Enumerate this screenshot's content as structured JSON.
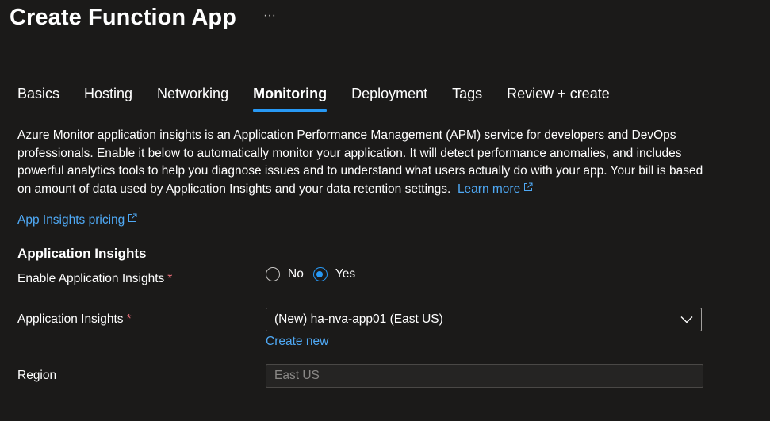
{
  "header": {
    "title": "Create Function App",
    "more_label": "···"
  },
  "tabs": [
    {
      "label": "Basics",
      "active": false
    },
    {
      "label": "Hosting",
      "active": false
    },
    {
      "label": "Networking",
      "active": false
    },
    {
      "label": "Monitoring",
      "active": true
    },
    {
      "label": "Deployment",
      "active": false
    },
    {
      "label": "Tags",
      "active": false
    },
    {
      "label": "Review + create",
      "active": false
    }
  ],
  "description": {
    "text": "Azure Monitor application insights is an Application Performance Management (APM) service for developers and DevOps professionals. Enable it below to automatically monitor your application. It will detect performance anomalies, and includes powerful analytics tools to help you diagnose issues and to understand what users actually do with your app. Your bill is based on amount of data used by Application Insights and your data retention settings.",
    "learn_more": "Learn more"
  },
  "pricing_link": "App Insights pricing",
  "section": {
    "title": "Application Insights"
  },
  "form": {
    "enable": {
      "label": "Enable Application Insights",
      "required_marker": "*",
      "options": [
        {
          "label": "No",
          "selected": false
        },
        {
          "label": "Yes",
          "selected": true
        }
      ]
    },
    "app_insights": {
      "label": "Application Insights",
      "required_marker": "*",
      "value": "(New) ha-nva-app01 (East US)",
      "create_new": "Create new"
    },
    "region": {
      "label": "Region",
      "value": "East US"
    }
  },
  "colors": {
    "background": "#1b1a19",
    "accent": "#2899f5",
    "link": "#4fa9f5",
    "required": "#f1707b"
  }
}
